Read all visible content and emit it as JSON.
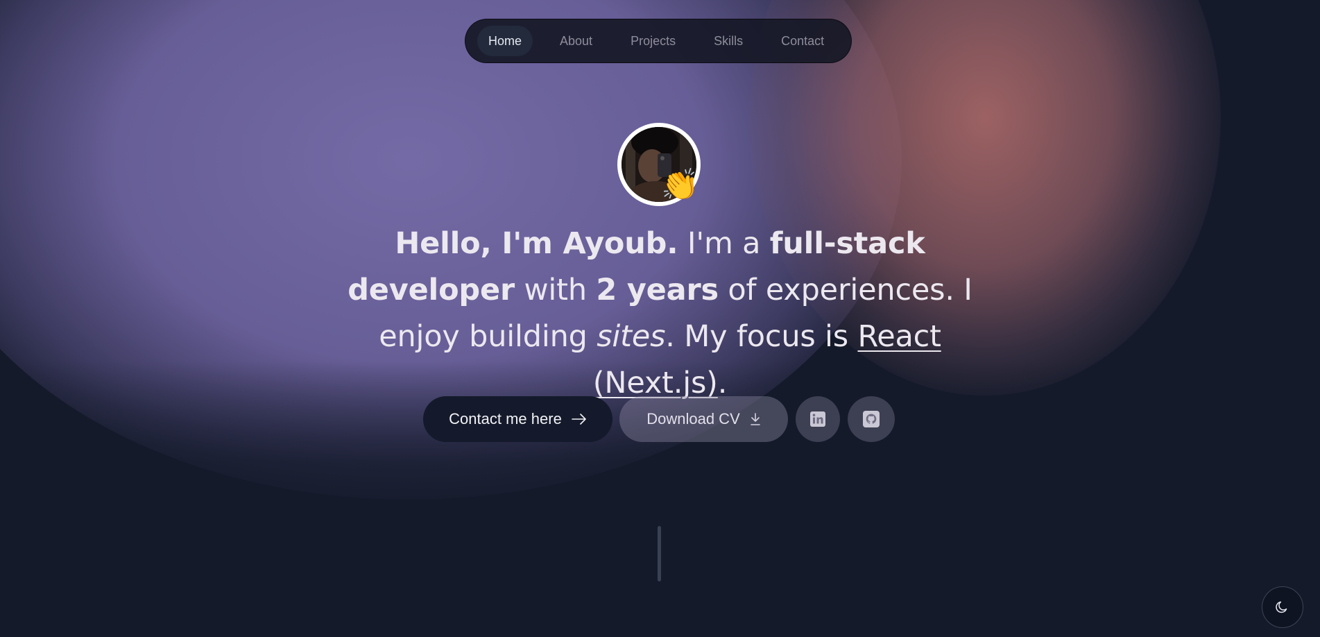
{
  "nav": {
    "items": [
      {
        "label": "Home",
        "active": true
      },
      {
        "label": "About",
        "active": false
      },
      {
        "label": "Projects",
        "active": false
      },
      {
        "label": "Skills",
        "active": false
      },
      {
        "label": "Contact",
        "active": false
      }
    ]
  },
  "hero": {
    "avatar_emoji": "👏",
    "headline": {
      "intro": "Hello, I'm Ayoub.",
      "text1": " I'm a ",
      "role": "full-stack developer",
      "text2": " with ",
      "years": "2 years",
      "text3": " of experiences. I enjoy building ",
      "sites": "sites",
      "text4": ". My focus is ",
      "focus": "React (Next.js)",
      "text5": "."
    }
  },
  "actions": {
    "contact_label": "Contact me here",
    "cv_label": "Download CV",
    "linkedin_icon": "linkedin-icon",
    "github_icon": "github-icon"
  },
  "theme": {
    "icon": "moon-icon"
  },
  "colors": {
    "background": "#141a2a",
    "accent_purple": "#6e64a0",
    "accent_rose": "#a86868",
    "button_dark": "#141a2b",
    "text": "#ece8ef"
  }
}
